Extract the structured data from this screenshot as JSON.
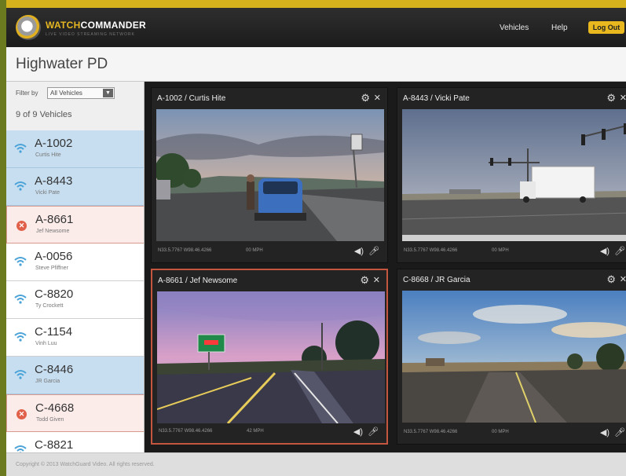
{
  "app": {
    "logo_brand_a": "WATCH",
    "logo_brand_b": "COMMANDER",
    "logo_tagline": "LIVE VIDEO STREAMING NETWORK",
    "accent_color": "#e8b81e"
  },
  "nav": {
    "vehicles": "Vehicles",
    "help": "Help",
    "logout": "Log Out"
  },
  "page": {
    "title": "Highwater PD"
  },
  "sidebar": {
    "filter_label": "Filter by",
    "filter_value": "All Vehicles",
    "count": "9 of 9 Vehicles",
    "vehicles": [
      {
        "id": "A-1002",
        "name": "Curtis Hite",
        "state": "active",
        "icon": "wifi-icon"
      },
      {
        "id": "A-8443",
        "name": "Vicki Pate",
        "state": "active",
        "icon": "wifi-icon"
      },
      {
        "id": "A-8661",
        "name": "Jef Newsome",
        "state": "alert",
        "icon": "alert-x-icon"
      },
      {
        "id": "A-0056",
        "name": "Steve Pfiffner",
        "state": "normal",
        "icon": "wifi-icon"
      },
      {
        "id": "C-8820",
        "name": "Ty Crockett",
        "state": "normal",
        "icon": "wifi-icon"
      },
      {
        "id": "C-1154",
        "name": "Vinh Luu",
        "state": "normal",
        "icon": "wifi-icon"
      },
      {
        "id": "C-8446",
        "name": "JR Garcia",
        "state": "active",
        "icon": "wifi-icon"
      },
      {
        "id": "C-4668",
        "name": "Todd Given",
        "state": "alert",
        "icon": "alert-x-icon"
      },
      {
        "id": "C-8821",
        "name": "",
        "state": "normal",
        "icon": "wifi-icon"
      }
    ]
  },
  "cameras": [
    {
      "title": "A-1002 / Curtis Hite",
      "gps": "N33.5.7767 W98.46.4266",
      "speed": "00 MPH"
    },
    {
      "title": "A-8443 / Vicki Pate",
      "gps": "N33.5.7767 W98.46.4266",
      "speed": "00 MPH"
    },
    {
      "title": "A-8661 / Jef Newsome",
      "gps": "N33.5.7767 W98.46.4266",
      "speed": "42 MPH"
    },
    {
      "title": "C-8668 / JR Garcia",
      "gps": "N33.5.7767 W98.46.4266",
      "speed": "00 MPH"
    }
  ],
  "footer": {
    "copyright": "Copyright © 2013 WatchGuard Video. All rights reserved."
  }
}
